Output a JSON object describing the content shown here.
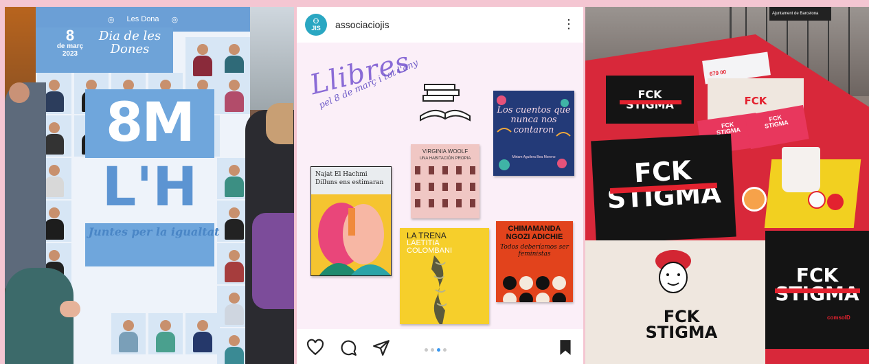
{
  "layout": {
    "background": "#f4c6d2"
  },
  "left_panel": {
    "banner": {
      "logo_text": "Les Dona",
      "date_day": "8",
      "date_month": "de març",
      "date_year": "2023",
      "title": "Dia de les Dones",
      "big_line1": "8M",
      "big_line2": "L'H",
      "slogan": "Juntes per la igualtat",
      "accent": "#6fa6dc"
    }
  },
  "instagram": {
    "username": "associaciojis",
    "avatar_text": "JIS",
    "post": {
      "handwritten_title": "Llibres",
      "handwritten_subtitle": "pel 8 de març i tot l'any",
      "books": [
        {
          "id": "cuentos",
          "title": "Los cuentos que nunca nos contaron",
          "author": "Miriam Aguilera  Bea Moreno"
        },
        {
          "id": "woolf",
          "author": "VIRGINIA WOOLF",
          "title": "UNA HABITACIÓN PROPIA"
        },
        {
          "id": "hachmi",
          "author": "Najat El Hachmi",
          "title": "Dilluns ens estimaran"
        },
        {
          "id": "trena",
          "title": "LA TRENA",
          "author_line1": "LAETITIA",
          "author_line2": "COLOMBANI"
        },
        {
          "id": "adichie",
          "author_line1": "CHIMAMANDA",
          "author_line2": "NGOZI ADICHIE",
          "title": "Todos deberíamos ser feministas"
        }
      ]
    },
    "actions": {
      "like_icon": "heart-icon",
      "comment_icon": "comment-icon",
      "share_icon": "send-icon",
      "save_icon": "bookmark-icon"
    },
    "carousel": {
      "count": 4,
      "active": 3
    },
    "accent": "#3897f0"
  },
  "right_panel": {
    "phone": "679 00",
    "sign": "Ajuntament de Barcelona",
    "bag_text_line1": "FCK",
    "bag_text_line2": "STIGMA",
    "brand": "comsoID",
    "colors": {
      "tablecloth": "#d8283a",
      "tray": "#f2d020"
    }
  }
}
